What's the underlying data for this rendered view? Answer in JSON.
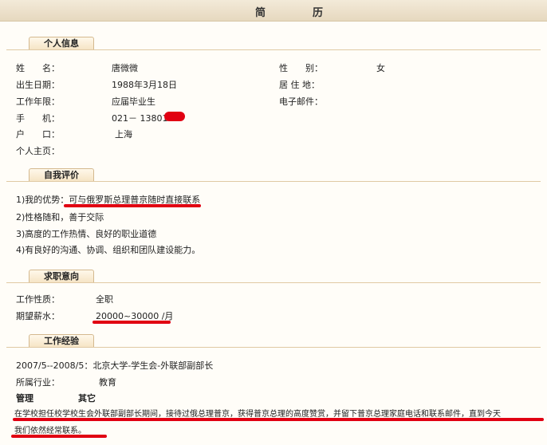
{
  "header": {
    "title_left": "简",
    "title_right": "历"
  },
  "personal": {
    "tab": "个人信息",
    "name_label": "姓　　名：",
    "name": "唐微微",
    "gender_label": "性　　别：",
    "gender": "女",
    "birth_label": "出生日期：",
    "birth": "1988年3月18日",
    "residence_label": "居 住 地：",
    "years_label": "工作年限：",
    "years": "应届毕业生",
    "email_label": "电子邮件：",
    "phone_label": "手　　机：",
    "phone": "021－ 1380174",
    "hukou_label": "户　　口：",
    "hukou": "上海",
    "homepage_label": "个人主页："
  },
  "self_eval": {
    "tab": "自我评价",
    "items": [
      "1)我的优势：可与俄罗斯总理普京随时直接联系",
      "2)性格随和，善于交际",
      "3)高度的工作热情、良好的职业道德",
      "4)有良好的沟通、协调、组织和团队建设能力。"
    ]
  },
  "job_intent": {
    "tab": "求职意向",
    "nature_label": "工作性质：",
    "nature": "全职",
    "salary_label": "期望薪水：",
    "salary": "20000~30000 /月"
  },
  "experience": {
    "tab": "工作经验",
    "period_line": "2007/5--2008/5：北京大学-学生会-外联部副部长",
    "industry_label": "所属行业：",
    "industry": "教育",
    "col1": "管理",
    "col2": "其它",
    "desc_line1": "在学校担任校学校生会外联部副部长期间，接待过俄总理普京，获得普京总理的高度赞赏，并留下普京总理家庭电话和联系邮件，直到今天",
    "desc_line2": "我们依然经常联系。"
  },
  "colors": {
    "highlight": "#e10012",
    "tab_border": "#d4b98f",
    "header_bg": "#e6d8bf"
  }
}
